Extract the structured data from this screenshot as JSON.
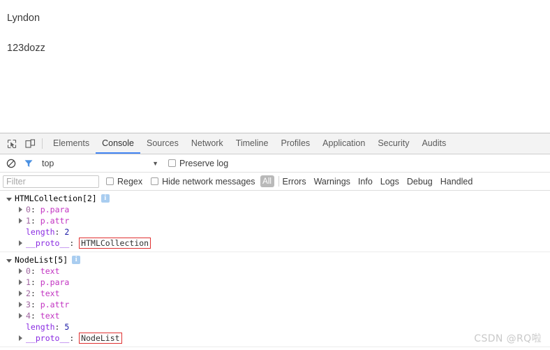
{
  "page": {
    "paragraphs": [
      "Lyndon",
      "123dozz"
    ]
  },
  "devtools": {
    "icons": {
      "inspect": "inspect-element-icon",
      "device": "device-toolbar-icon",
      "clear": "clear-console-icon",
      "filter": "filter-funnel-icon"
    },
    "tabs": [
      {
        "label": "Elements",
        "selected": false
      },
      {
        "label": "Console",
        "selected": true
      },
      {
        "label": "Sources",
        "selected": false
      },
      {
        "label": "Network",
        "selected": false
      },
      {
        "label": "Timeline",
        "selected": false
      },
      {
        "label": "Profiles",
        "selected": false
      },
      {
        "label": "Application",
        "selected": false
      },
      {
        "label": "Security",
        "selected": false
      },
      {
        "label": "Audits",
        "selected": false
      }
    ],
    "context": {
      "value": "top",
      "caret": "▼"
    },
    "preserve_log": {
      "label": "Preserve log",
      "checked": false
    },
    "filter": {
      "placeholder": "Filter",
      "value": ""
    },
    "regex": {
      "label": "Regex",
      "checked": false
    },
    "hide_network": {
      "label": "Hide network messages",
      "checked": false
    },
    "levels": {
      "pill": "All",
      "items": [
        "Errors",
        "Warnings",
        "Info",
        "Logs",
        "Debug",
        "Handled"
      ]
    }
  },
  "console": {
    "messages": [
      {
        "header": "HTMLCollection[2]",
        "info_icon": "i",
        "rows": [
          {
            "expandable": true,
            "key": "0",
            "key_type": "index",
            "sep": ": ",
            "value": "p.para",
            "value_type": "node",
            "boxed": false
          },
          {
            "expandable": true,
            "key": "1",
            "key_type": "index",
            "sep": ": ",
            "value": "p.attr",
            "value_type": "node",
            "boxed": false
          },
          {
            "expandable": false,
            "key": "length",
            "key_type": "name",
            "sep": ": ",
            "value": "2",
            "value_type": "num",
            "boxed": false
          },
          {
            "expandable": true,
            "key": "__proto__",
            "key_type": "name",
            "sep": ": ",
            "value": "HTMLCollection",
            "value_type": "proto",
            "boxed": true
          }
        ]
      },
      {
        "header": "NodeList[5]",
        "info_icon": "i",
        "rows": [
          {
            "expandable": true,
            "key": "0",
            "key_type": "index",
            "sep": ": ",
            "value": "text",
            "value_type": "node",
            "boxed": false
          },
          {
            "expandable": true,
            "key": "1",
            "key_type": "index",
            "sep": ": ",
            "value": "p.para",
            "value_type": "node",
            "boxed": false
          },
          {
            "expandable": true,
            "key": "2",
            "key_type": "index",
            "sep": ": ",
            "value": "text",
            "value_type": "node",
            "boxed": false
          },
          {
            "expandable": true,
            "key": "3",
            "key_type": "index",
            "sep": ": ",
            "value": "p.attr",
            "value_type": "node",
            "boxed": false
          },
          {
            "expandable": true,
            "key": "4",
            "key_type": "index",
            "sep": ": ",
            "value": "text",
            "value_type": "node",
            "boxed": false
          },
          {
            "expandable": false,
            "key": "length",
            "key_type": "name",
            "sep": ": ",
            "value": "5",
            "value_type": "num",
            "boxed": false
          },
          {
            "expandable": true,
            "key": "__proto__",
            "key_type": "name",
            "sep": ": ",
            "value": "NodeList",
            "value_type": "proto",
            "boxed": true
          }
        ]
      }
    ]
  },
  "watermark": "CSDN @RQ啦"
}
